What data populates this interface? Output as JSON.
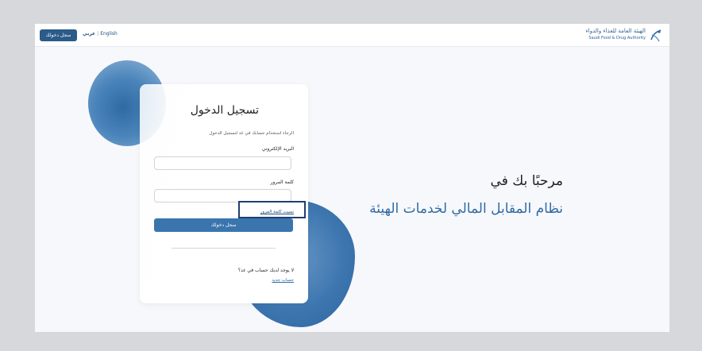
{
  "header": {
    "logo": {
      "name_ar": "الهيئة العامة للغذاء والدواء",
      "name_en": "Saudi Food & Drug Authority"
    },
    "language": {
      "arabic": "عربي",
      "separator": "|",
      "english": "English"
    },
    "login_button": "سجل دخولك"
  },
  "login_card": {
    "title": "تسجيل الدخول",
    "subtitle": "الرجاء استخدام حسابك في غد لتسجيل الدخول",
    "email_label": "البريد الإلكتروني",
    "email_value": "",
    "password_label": "كلمة المرور",
    "password_value": "",
    "forgot_password": "نسيت كلمة المرور",
    "submit_button": "سجل دخولك",
    "no_account": "لا يوجد لديك حساب في غد؟",
    "new_account": "حساب جديد"
  },
  "welcome": {
    "line1": "مرحبًا بك في",
    "line2": "نظام المقابل المالي لخدمات الهيئة"
  },
  "colors": {
    "brand_blue": "#2a5b89",
    "accent_blue": "#3a75ad",
    "highlight_border": "#1f3f73"
  }
}
